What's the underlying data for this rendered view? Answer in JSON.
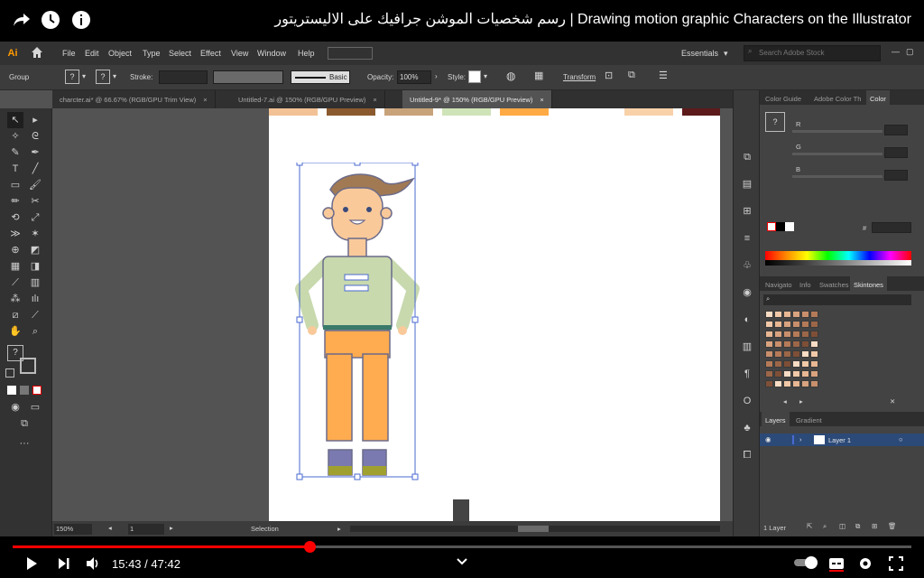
{
  "video": {
    "title": "رسم شخصيات الموشن جرافيك على الاليستريتور | Drawing motion graphic Characters on the Illustrator",
    "current_time": "15:43",
    "separator": " / ",
    "duration": "47:42",
    "progress_fraction": 0.33,
    "icons": [
      "share-icon",
      "watch-later-icon",
      "info-icon",
      "play-icon",
      "next-icon",
      "volume-icon",
      "chevron-down-icon",
      "autoplay-toggle",
      "subtitles-icon",
      "settings-icon",
      "fullscreen-icon"
    ]
  },
  "illustrator": {
    "logo": "Ai",
    "menu": [
      "File",
      "Edit",
      "Object",
      "Type",
      "Select",
      "Effect",
      "View",
      "Window",
      "Help"
    ],
    "workspace": "Essentials",
    "search_placeholder": "Search Adobe Stock",
    "control": {
      "selection_label": "Group",
      "stroke_label": "Stroke:",
      "brush_label": "Basic",
      "opacity_label": "Opacity:",
      "opacity_value": "100%",
      "style_label": "Style:",
      "transform_label": "Transform"
    },
    "tabs": [
      {
        "label": "charcter.ai* @ 66.67% (RGB/GPU Trim View)",
        "close": "×"
      },
      {
        "label": "Untitled-7.ai @ 150% (RGB/GPU Preview)",
        "close": "×"
      },
      {
        "label": "Untitled-9* @ 150% (RGB/GPU Preview)",
        "close": "×"
      }
    ],
    "status": {
      "zoom": "150%",
      "artboard": "1",
      "tool": "Selection"
    },
    "panels": {
      "color_tabs": [
        "Color Guide",
        "Adobe Color Th",
        "Color"
      ],
      "color_channels": [
        "R",
        "G",
        "B"
      ],
      "hex_symbol": "#",
      "swatch_tabs": [
        "Navigato",
        "Info",
        "Swatches",
        "Skintones"
      ],
      "layer_tabs": [
        "Layers",
        "Gradient"
      ],
      "layer_name": "Layer 1",
      "layer_count": "1 Layer"
    },
    "swatch_colors": [
      "#f2c195",
      "#8a5a2e",
      "#c8a37a",
      "#cfe3b8",
      "#ffaa44",
      "#f8d1a9",
      "#5c1a1a"
    ],
    "skintones": [
      "#f9dcc4",
      "#f2c9a8",
      "#e8b793",
      "#d9a37f",
      "#c98f6c",
      "#b57a58",
      "#9c6648",
      "#7e4f37"
    ]
  },
  "colors": {
    "hair": "#a17a54",
    "skin": "#f9c99a",
    "shirt": "#c8d9ae",
    "pants": "#ffab4f",
    "outline": "#6b6b8a",
    "selection": "#4a6ad0"
  }
}
